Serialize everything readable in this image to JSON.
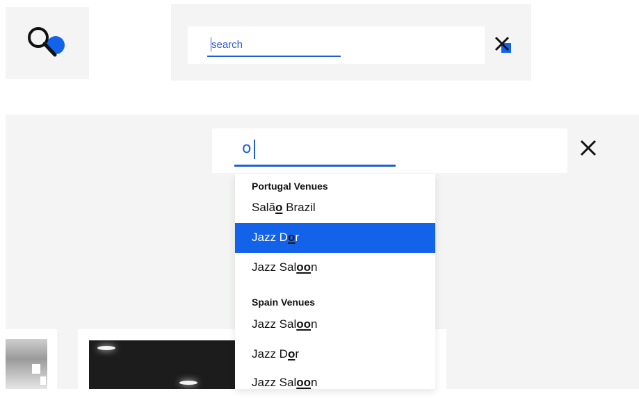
{
  "top": {
    "search_placeholder": "search",
    "icons": {
      "search": "search-icon",
      "close": "close-icon"
    }
  },
  "main": {
    "query": "o",
    "icons": {
      "close": "close-icon"
    },
    "dropdown": {
      "groups": [
        {
          "title": "Portugal Venues",
          "items": [
            {
              "pre": "Salã",
              "match": "o",
              "post": " Brazil"
            },
            {
              "pre": "Jazz D",
              "match": "o",
              "post": "r",
              "active": true
            },
            {
              "pre": "Jazz Sal",
              "match": "oo",
              "post": "n"
            }
          ]
        },
        {
          "title": "Spain Venues",
          "items": [
            {
              "pre": "Jazz Sal",
              "match": "oo",
              "post": "n"
            },
            {
              "pre": "Jazz D",
              "match": "o",
              "post": "r"
            },
            {
              "pre": "Jazz Sal",
              "match": "oo",
              "post": "n"
            }
          ]
        }
      ]
    }
  },
  "colors": {
    "accent": "#1262ea",
    "panel": "#f3f4f3"
  }
}
